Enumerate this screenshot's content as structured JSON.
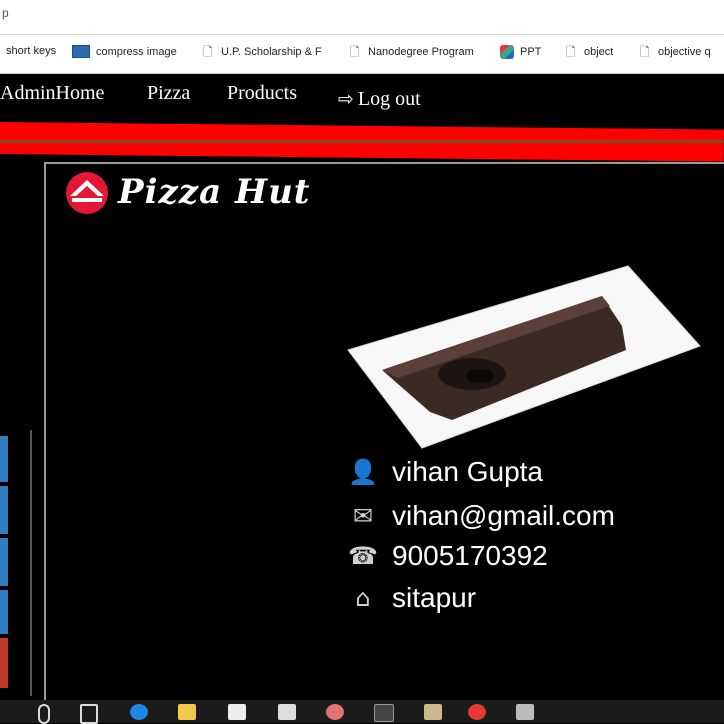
{
  "browser": {
    "address_text": "p",
    "bookmarks": [
      {
        "label": "short keys",
        "icon": "none"
      },
      {
        "label": "compress image",
        "icon": "compress-image-icon"
      },
      {
        "label": "U.P. Scholarship & F",
        "icon": "page-icon"
      },
      {
        "label": "Nanodegree Program",
        "icon": "page-icon"
      },
      {
        "label": "PPT",
        "icon": "ppt-icon"
      },
      {
        "label": "object",
        "icon": "page-icon"
      },
      {
        "label": "objective q",
        "icon": "page-icon"
      }
    ]
  },
  "nav": {
    "items": [
      "AdminHome",
      "Pizza",
      "Products"
    ],
    "logout_label": "Log out",
    "logout_icon": "sign-out-icon"
  },
  "logo": {
    "text": "Pizza Hut",
    "icon": "pizza-hut-roof-icon",
    "color": "#e31837"
  },
  "product": {
    "image": "chocolate-lava-cake-on-white-plate"
  },
  "profile": {
    "name": "vihan Gupta",
    "email": "vihan@gmail.com",
    "phone": "9005170392",
    "city": "sitapur"
  },
  "colors": {
    "band": "#ff0000",
    "background": "#000000",
    "accent_strip": "#2f7fc1"
  }
}
